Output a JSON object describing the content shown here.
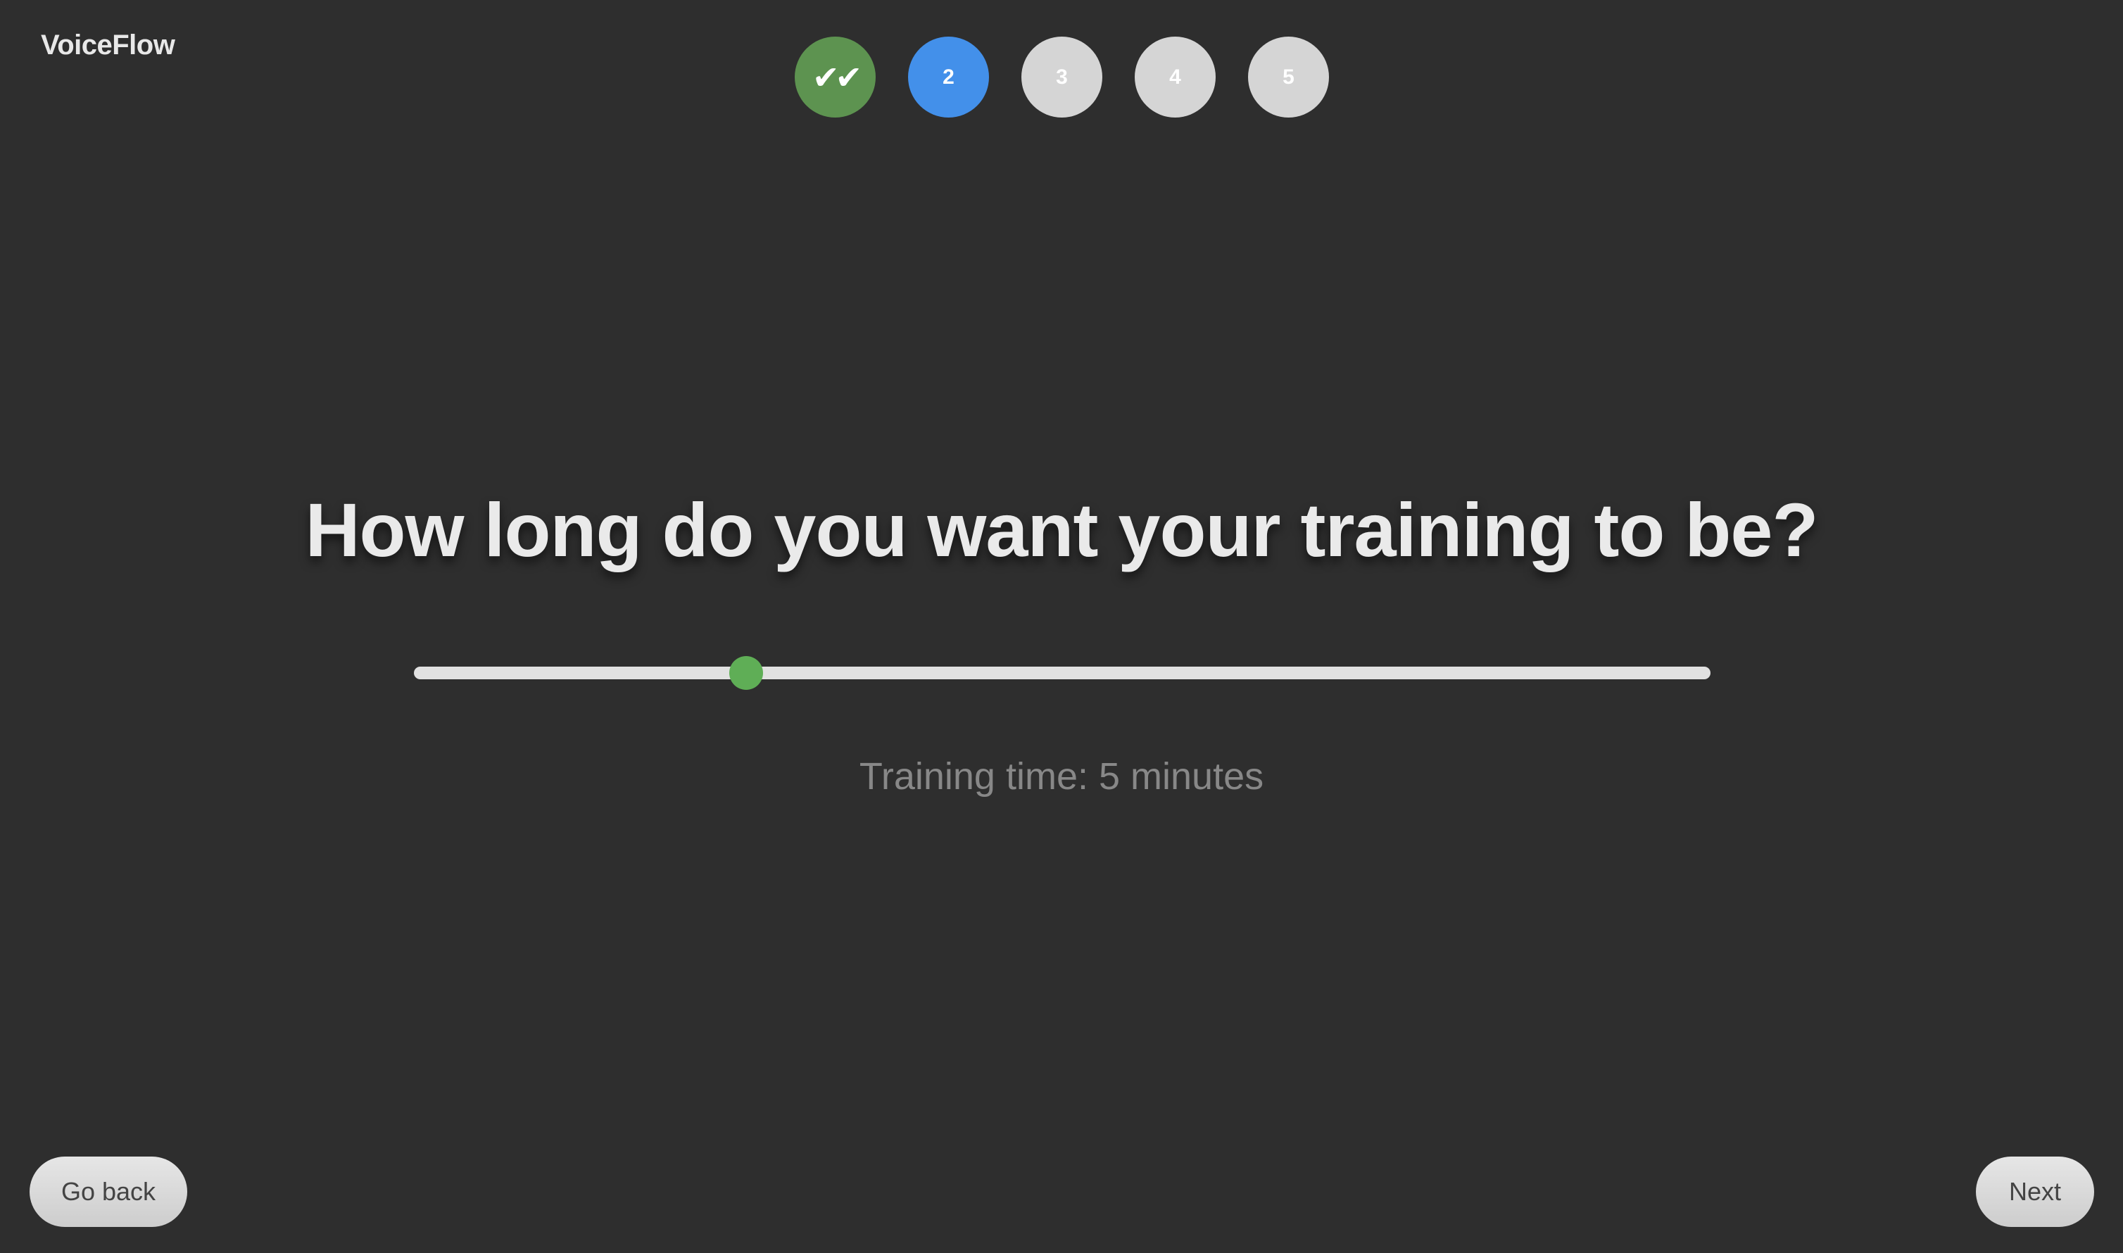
{
  "app": {
    "logo_text": "VoiceFlow"
  },
  "stepper": {
    "steps": [
      {
        "label": "✔✔",
        "state": "completed",
        "color": "#5d9350"
      },
      {
        "label": "2",
        "state": "current",
        "color": "#4390ea"
      },
      {
        "label": "3",
        "state": "pending",
        "color": "#d5d5d5"
      },
      {
        "label": "4",
        "state": "pending",
        "color": "#d5d5d5"
      },
      {
        "label": "5",
        "state": "pending",
        "color": "#d5d5d5"
      }
    ]
  },
  "main": {
    "question": "How long do you want your training to be?",
    "slider": {
      "position_fraction": 0.256,
      "track_color": "#e1e1e1",
      "thumb_color": "#5fae56"
    },
    "time_label": "Training time: 5 minutes"
  },
  "footer": {
    "back_label": "Go back",
    "next_label": "Next"
  }
}
